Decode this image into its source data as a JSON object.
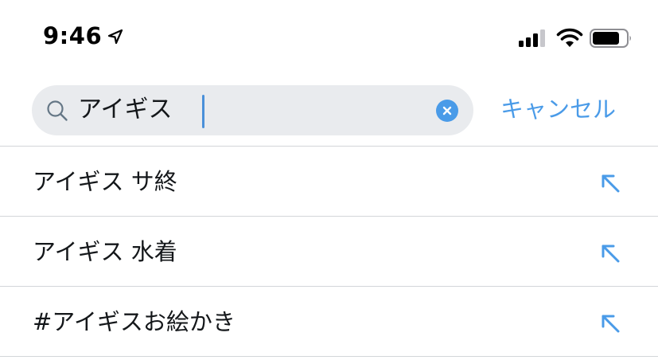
{
  "status_bar": {
    "time": "9:46",
    "icons": [
      "location-icon",
      "signal-icon",
      "wifi-icon",
      "battery-icon"
    ]
  },
  "search": {
    "value": "アイギス",
    "cancel_label": "キャンセル",
    "icons": [
      "search-icon",
      "clear-icon"
    ]
  },
  "suggestions": [
    {
      "label": "アイギス サ終",
      "icon": "fill-arrow-icon"
    },
    {
      "label": "アイギス 水着",
      "icon": "fill-arrow-icon"
    },
    {
      "label": "#アイギスお絵かき",
      "icon": "fill-arrow-icon"
    }
  ],
  "colors": {
    "accent": "#4a9be8",
    "search_background": "#e9ebee",
    "divider": "#d3d6d9",
    "text": "#14171a"
  }
}
